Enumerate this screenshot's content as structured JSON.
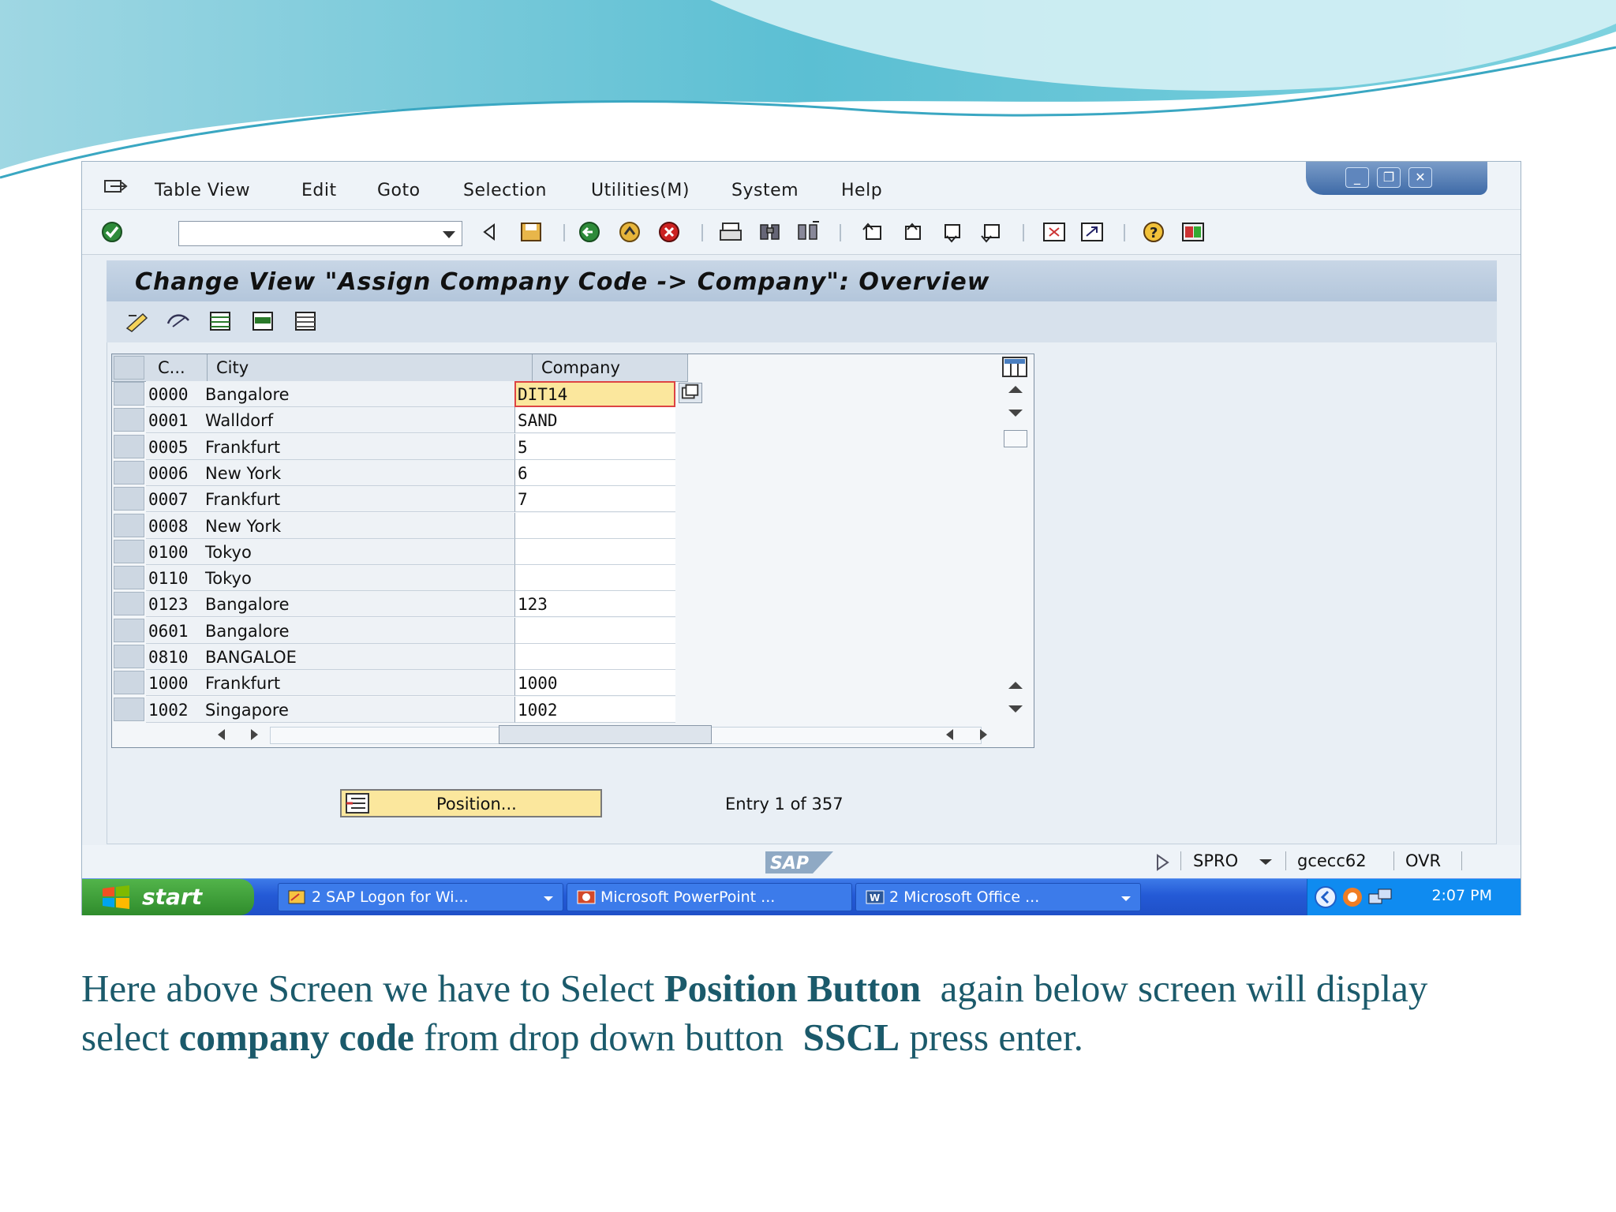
{
  "colors": {
    "caption": "#1b5a6b",
    "highlight": "#fbe79d",
    "taskbar": "#245ad6",
    "start": "#2f8c2c"
  },
  "menu": {
    "items": [
      "Table View",
      "Edit",
      "Goto",
      "Selection",
      "Utilities(M)",
      "System",
      "Help"
    ]
  },
  "toolbar": {
    "command_value": ""
  },
  "title": "Change View \"Assign Company Code -> Company\": Overview",
  "table": {
    "headers": {
      "code": "C...",
      "city": "City",
      "company": "Company"
    },
    "rows": [
      {
        "code": "0000",
        "city": "Bangalore",
        "company": "DIT14"
      },
      {
        "code": "0001",
        "city": "Walldorf",
        "company": "SAND"
      },
      {
        "code": "0005",
        "city": "Frankfurt",
        "company": "5"
      },
      {
        "code": "0006",
        "city": "New York",
        "company": "6"
      },
      {
        "code": "0007",
        "city": "Frankfurt",
        "company": "7"
      },
      {
        "code": "0008",
        "city": "New York",
        "company": ""
      },
      {
        "code": "0100",
        "city": "Tokyo",
        "company": ""
      },
      {
        "code": "0110",
        "city": "Tokyo",
        "company": ""
      },
      {
        "code": "0123",
        "city": "Bangalore",
        "company": "123"
      },
      {
        "code": "0601",
        "city": "Bangalore",
        "company": ""
      },
      {
        "code": "0810",
        "city": "BANGALOE",
        "company": ""
      },
      {
        "code": "1000",
        "city": "Frankfurt",
        "company": "1000"
      },
      {
        "code": "1002",
        "city": "Singapore",
        "company": "1002"
      }
    ]
  },
  "position_button": {
    "label": "Position..."
  },
  "entry_text": "Entry 1 of 357",
  "statusbar": {
    "logo": "SAP",
    "transaction": "SPRO",
    "server": "gcecc62",
    "mode": "OVR"
  },
  "taskbar": {
    "start": "start",
    "tasks": [
      "2 SAP Logon for Wi...",
      "Microsoft PowerPoint ...",
      "2 Microsoft Office ..."
    ],
    "clock": "2:07 PM"
  },
  "caption": {
    "line1_a": "Here above Screen we have to Select ",
    "line1_bold": "Position Button",
    "line1_b": "  again below screen will display",
    "line2_a": "select ",
    "line2_bold1": "company code",
    "line2_b": " from drop down button  ",
    "line2_bold2": "SSCL",
    "line2_c": " press enter."
  }
}
